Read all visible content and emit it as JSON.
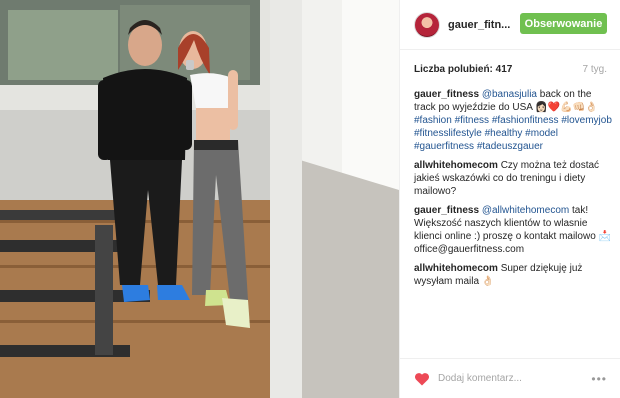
{
  "header": {
    "username": "gauer_fitn...",
    "follow_label": "Obserwowanie"
  },
  "stats": {
    "likes": "Liczba polubień: 417",
    "time": "7 tyg."
  },
  "comments": [
    {
      "user": "gauer_fitness",
      "parts": [
        {
          "type": "link",
          "text": "@banasjulia"
        },
        {
          "type": "text",
          "text": " back on the track po wyjeździe do USA "
        },
        {
          "type": "emoji",
          "text": "👩🏻‍❤️💪🏻👊🏻👌🏻"
        },
        {
          "type": "text",
          "text": " "
        },
        {
          "type": "link",
          "text": "#fashion #fitness #fashionfitness #lovemyjob #fitnesslifestyle #healthy #model #gauerfitness #tadeuszgauer"
        }
      ]
    },
    {
      "user": "allwhitehomecom",
      "parts": [
        {
          "type": "text",
          "text": " Czy można też dostać jakieś wskazówki co do treningu i diety mailowo?"
        }
      ]
    },
    {
      "user": "gauer_fitness",
      "parts": [
        {
          "type": "link",
          "text": "@allwhitehomecom"
        },
        {
          "type": "text",
          "text": " tak! Większość naszych klientów to wlasnie klienci online :) proszę o kontakt mailowo "
        },
        {
          "type": "emoji",
          "text": "📩"
        },
        {
          "type": "text",
          "text": " office@gauerfitness.com"
        }
      ]
    },
    {
      "user": "allwhitehomecom",
      "parts": [
        {
          "type": "text",
          "text": " Super dziękuję już wysyłam maila "
        },
        {
          "type": "emoji",
          "text": "👌🏻"
        }
      ]
    }
  ],
  "footer": {
    "add_comment_placeholder": "Dodaj komentarz...",
    "more": "•••"
  },
  "colors": {
    "follow_bg": "#70c050",
    "link": "#235591",
    "heart": "#ed4956"
  }
}
